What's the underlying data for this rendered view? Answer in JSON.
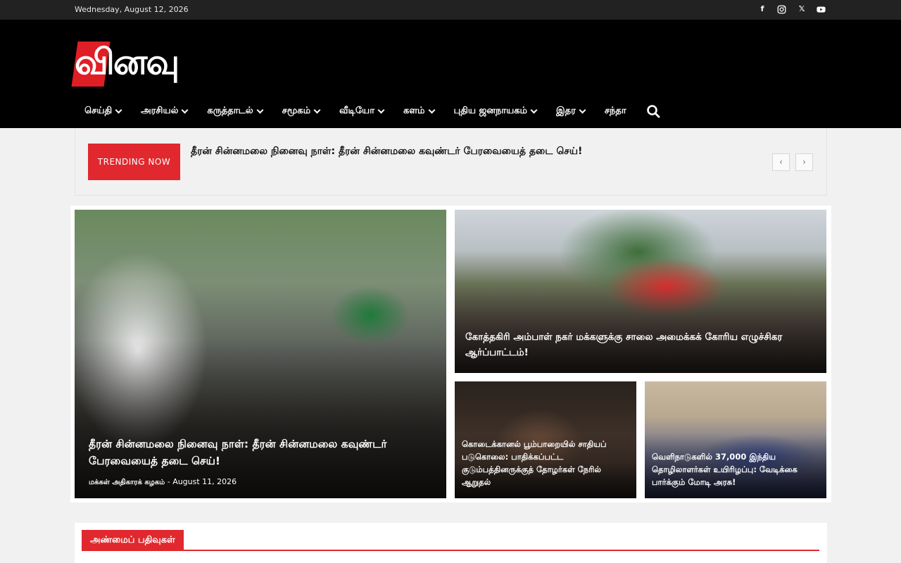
{
  "topbar": {
    "date": "Wednesday, August 12, 2026",
    "socials": [
      {
        "icon": "facebook-icon",
        "glyph": "f"
      },
      {
        "icon": "instagram-icon"
      },
      {
        "icon": "x-twitter-icon",
        "glyph": "𝕏"
      },
      {
        "icon": "youtube-icon"
      }
    ]
  },
  "header": {
    "logo_text": "வினவு",
    "nav": [
      {
        "label": "செய்தி",
        "dropdown": true
      },
      {
        "label": "அரசியல்",
        "dropdown": true
      },
      {
        "label": "கருத்தாடல்",
        "dropdown": true
      },
      {
        "label": "சமூகம்",
        "dropdown": true
      },
      {
        "label": "வீடியோ",
        "dropdown": true
      },
      {
        "label": "களம்",
        "dropdown": true
      },
      {
        "label": "புதிய ஜனநாயகம்",
        "dropdown": true
      },
      {
        "label": "இதர",
        "dropdown": true
      },
      {
        "label": "சந்தா",
        "dropdown": false
      }
    ],
    "search_icon": "search-icon"
  },
  "trending": {
    "label": "TRENDING NOW",
    "title": "தீரன் சின்னமலை நினைவு நாள்: தீரன் சின்னமலை கவுண்டர் பேரவையைத் தடை செய்!",
    "prev": "‹",
    "next": "›"
  },
  "featured": {
    "main": {
      "title": "தீரன் சின்னமலை நினைவு நாள்: தீரன் சின்னமலை கவுண்டர் பேரவையைத் தடை செய்!",
      "author": "மக்கள் அதிகாரக் கழகம்",
      "separator": "-",
      "date": "August 11, 2026"
    },
    "top": {
      "title": "கோத்தகிரி அம்பாள் நகர் மக்களுக்கு சாலை அமைக்கக் கோரிய எழுச்சிகர ஆர்ப்பாட்டம்!"
    },
    "bottom_left": {
      "title": "கொடைக்கானல் பூம்பாறையில் சாதியப் படுகொலை: பாதிக்கப்பட்ட குடும்பத்தினருக்குத் தோழர்கள் நேரில் ஆறுதல்"
    },
    "bottom_right": {
      "title": "வெளிநாடுகளில் 37,000 இந்திய தொழிலாளர்கள் உயிரிழப்பு: வேடிக்கை பார்க்கும் மோடி அரசு!"
    }
  },
  "recent": {
    "title": "அண்மைப் பதிவுகள்"
  },
  "colors": {
    "accent": "#e0282e",
    "header_bg": "#000000",
    "topbar_bg": "#222222"
  }
}
